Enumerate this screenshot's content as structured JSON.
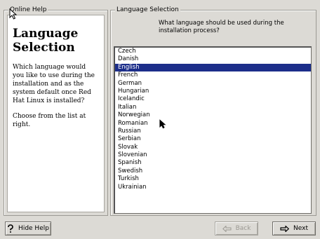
{
  "help_panel": {
    "frame_title": "Online Help",
    "title": "Language Selection",
    "paragraphs": [
      "Which language would you like to use during the installation and as the system default once Red Hat Linux is installed?",
      "Choose from the list at right."
    ]
  },
  "language_panel": {
    "frame_title": "Language Selection",
    "question": "What language should be used during the installation process?",
    "languages": [
      "Czech",
      "Danish",
      "English",
      "French",
      "German",
      "Hungarian",
      "Icelandic",
      "Italian",
      "Norwegian",
      "Romanian",
      "Russian",
      "Serbian",
      "Slovak",
      "Slovenian",
      "Spanish",
      "Swedish",
      "Turkish",
      "Ukrainian"
    ],
    "selected": "English"
  },
  "buttons": {
    "hide_help": "Hide Help",
    "back": "Back",
    "next": "Next"
  },
  "icons": {
    "hide_help": "question-icon",
    "back": "back-arrow-icon",
    "next": "next-arrow-icon"
  },
  "colors": {
    "selection": "#1c2e8a",
    "background": "#dcdad5"
  }
}
